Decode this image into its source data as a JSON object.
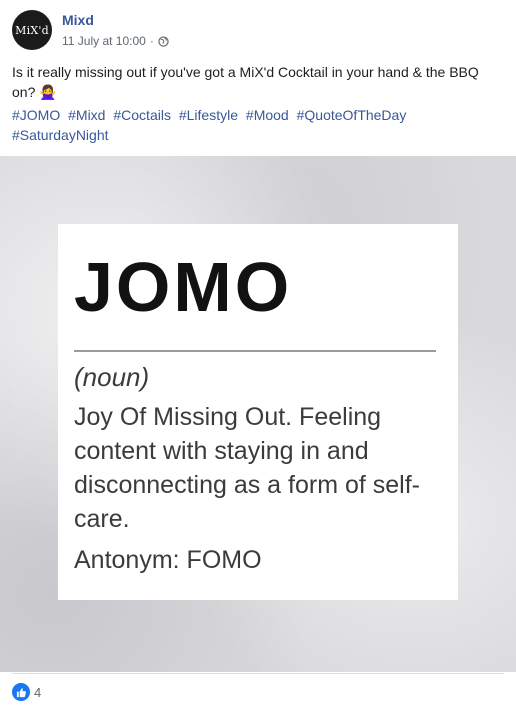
{
  "post": {
    "author": "Mixd",
    "avatar_text": "MiX'd",
    "timestamp": "11 July at 10:00",
    "separator": "·",
    "privacy_icon": "globe-icon",
    "text": "Is it really missing out if you've got a MiX'd Cocktail in your hand & the BBQ on? 🙅‍♀️",
    "hashtags": [
      "#JOMO",
      "#Mixd",
      "#Coctails",
      "#Lifestyle",
      "#Mood",
      "#QuoteOfTheDay",
      "#SaturdayNight"
    ]
  },
  "image": {
    "word": "JOMO",
    "part_of_speech": "(noun)",
    "definition": "Joy Of Missing Out. Feeling content with staying in and disconnecting as a form of self-care.",
    "antonym": "Antonym: FOMO",
    "background_color": "#d9d9dc"
  },
  "reactions": {
    "icon": "like-icon",
    "count": "4",
    "accent": "#1877f2"
  },
  "colors": {
    "link": "#385898",
    "meta": "#606770"
  }
}
